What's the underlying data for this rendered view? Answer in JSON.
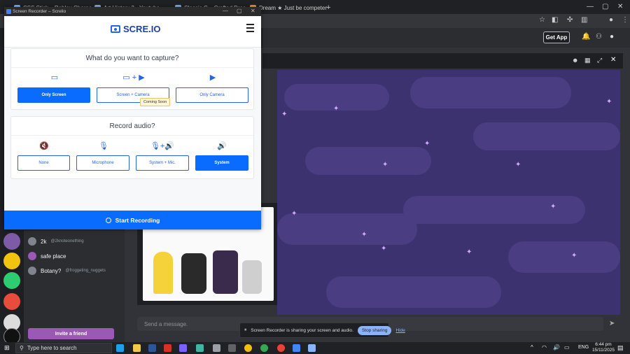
{
  "browser": {
    "tabs": [
      {
        "label": "CSS Stick... Roblox Charac..."
      },
      {
        "label": "Art History 2 - Youtube..."
      },
      {
        "label": "Classic C... Crafted Dreams..."
      },
      {
        "label": "Dream ★ Just be competent"
      }
    ],
    "new_tab": "+"
  },
  "recorder": {
    "window_title": "Screen Recorder – Screlio",
    "logo_text": "SCRE.IO",
    "capture": {
      "question": "What do you want to capture?",
      "options": [
        {
          "label": "Only Screen",
          "icon": "monitor-icon",
          "selected": true
        },
        {
          "label": "Screen + Camera",
          "icon": "monitor-plus-camera-icon",
          "selected": false
        },
        {
          "label": "Only Camera",
          "icon": "camera-icon",
          "selected": false
        }
      ],
      "tooltip": "Coming Soon"
    },
    "audio": {
      "question": "Record audio?",
      "options": [
        {
          "label": "None",
          "icon": "mute-icon",
          "selected": false
        },
        {
          "label": "Microphone",
          "icon": "microphone-icon",
          "selected": false
        },
        {
          "label": "System + Mic.",
          "icon": "mic-plus-speaker-icon",
          "selected": false
        },
        {
          "label": "System",
          "icon": "speaker-icon",
          "selected": true
        }
      ]
    },
    "start_label": "Start Recording",
    "accent": "#0a6cff"
  },
  "discord": {
    "get_app": "Get App",
    "members": [
      {
        "name": "2k",
        "sub": "@2knoteonething"
      },
      {
        "name": "safe place",
        "sub": ""
      },
      {
        "name": "Botany?",
        "sub": "@froggeting_nuggets"
      }
    ],
    "invite_label": "Invite a friend",
    "message_placeholder": "Send a message.",
    "share_banner": {
      "text": "Screen Recorder is sharing your screen and audio.",
      "stop": "Stop sharing",
      "hide": "Hide"
    }
  },
  "taskbar": {
    "search_placeholder": "Type here to search",
    "language": "ENG",
    "time": "6:44 pm",
    "date": "15/11/2025"
  }
}
